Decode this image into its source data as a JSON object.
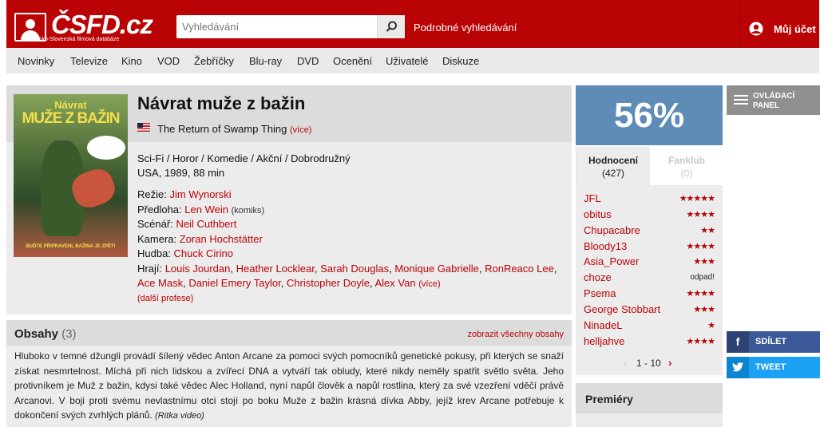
{
  "header": {
    "logo_text": "ČSFD.cz",
    "logo_subtitle": "Česko-Slovenská filmová databáze",
    "search_placeholder": "Vyhledávání",
    "advanced_search": "Podrobné vyhledávání",
    "account_label": "Můj účet"
  },
  "nav": {
    "items": [
      "Novinky",
      "Televize",
      "Kino",
      "VOD",
      "Žebříčky",
      "Blu-ray",
      "DVD",
      "Ocenění",
      "Uživatelé",
      "Diskuze"
    ]
  },
  "film": {
    "title": "Návrat muže z bažin",
    "original_title": "The Return of Swamp Thing",
    "original_more": "(více)",
    "genre": "Sci-Fi / Horor / Komedie / Akční / Dobrodružný",
    "origin": "USA, 1989, 88 min",
    "poster": {
      "line1": "Návrat",
      "line2": "MUŽE Z BAŽIN",
      "tagline": "BUĎTE PŘIPRAVENI, BAŽINA JE ZPĚT!"
    },
    "creators": {
      "director": {
        "label": "Režie:",
        "names": [
          "Jim Wynorski"
        ]
      },
      "source": {
        "label": "Předloha:",
        "names": [
          "Len Wein"
        ],
        "note": "(komiks)"
      },
      "writer": {
        "label": "Scénář:",
        "names": [
          "Neil Cuthbert"
        ]
      },
      "camera": {
        "label": "Kamera:",
        "names": [
          "Zoran Hochstätter"
        ]
      },
      "music": {
        "label": "Hudba:",
        "names": [
          "Chuck Cirino"
        ]
      },
      "cast": {
        "label": "Hrají:",
        "names": [
          "Louis Jourdan",
          "Heather Locklear",
          "Sarah Douglas",
          "Monique Gabrielle",
          "RonReaco Lee",
          "Ace Mask",
          "Daniel Emery Taylor",
          "Christopher Doyle",
          "Alex Van"
        ],
        "more": "(více)"
      }
    },
    "more_professions": "(další profese)"
  },
  "plot": {
    "title": "Obsahy",
    "count": "(3)",
    "show_all": "zobrazit všechny obsahy",
    "text": "Hluboko v temné džungli provádí šílený vědec Anton Arcane za pomoci svých pomocníků genetické pokusy, při kterých se snaží získat nesmrtelnost. Míchá při nich lidskou a zvířecí DNA a vytváří tak obludy, které nikdy neměly spatřit světlo světa. Jeho protivníkem je Muž z bažin, kdysi také vědec Alec Holland, nyní napůl člověk a napůl rostlina, který za své vzezření vděčí právě Arcanovi. V boji proti svému nevlastnímu otci stojí po boku Muže z bažin krásná dívka Abby, jejíž krev Arcane potřebuje k dokončení svých zvrhlých plánů.",
    "source": "(Ritka video)"
  },
  "rating": {
    "value": "56%",
    "color": "#5f8bb7",
    "tab_ratings": "Hodnocení",
    "tab_ratings_count": "(427)",
    "tab_fanclub": "Fanklub",
    "tab_fanclub_count": "(0)",
    "entries": [
      {
        "user": "JFL",
        "stars": "★★★★★"
      },
      {
        "user": "obitus",
        "stars": "★★★★"
      },
      {
        "user": "Chupacabre",
        "stars": "★★"
      },
      {
        "user": "Bloody13",
        "stars": "★★★★"
      },
      {
        "user": "Asia_Power",
        "stars": "★★★"
      },
      {
        "user": "choze",
        "stars": "odpad!"
      },
      {
        "user": "Psema",
        "stars": "★★★★"
      },
      {
        "user": "George Stobbart",
        "stars": "★★★"
      },
      {
        "user": "NinadeL",
        "stars": "★"
      },
      {
        "user": "helljahve",
        "stars": "★★★★"
      }
    ],
    "pager": {
      "prev": "‹",
      "range": "1 - 10",
      "next": "›"
    }
  },
  "premiery": {
    "title": "Premiéry"
  },
  "side": {
    "control_panel": "OVLÁDACÍ PANEL",
    "share_fb": "SDÍLET",
    "share_tw": "TWEET",
    "fb_icon": "f"
  },
  "colors": {
    "brand": "#ba0305",
    "facebook": "#3b5998",
    "twitter": "#1da1f2"
  }
}
